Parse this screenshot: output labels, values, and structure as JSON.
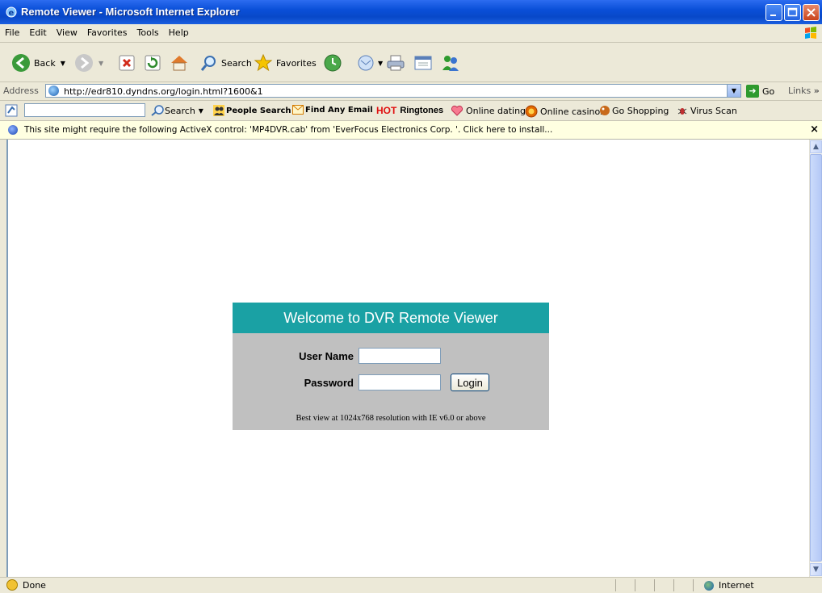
{
  "window": {
    "title": "Remote Viewer - Microsoft Internet Explorer"
  },
  "menu": [
    "File",
    "Edit",
    "View",
    "Favorites",
    "Tools",
    "Help"
  ],
  "toolbar": {
    "back": "Back",
    "search": "Search",
    "favorites": "Favorites"
  },
  "address": {
    "label": "Address",
    "url": "http://edr810.dyndns.org/login.html?1600&1",
    "go": "Go",
    "links": "Links"
  },
  "searchbar": {
    "search_label": "Search",
    "people_search": "People Search",
    "find_email": "Find Any Email",
    "hot": "HOT",
    "ringtones": "Ringtones",
    "online_dating": "Online dating",
    "online_casinos": "Online casinos",
    "go_shopping": "Go Shopping",
    "virus_scan": "Virus Scan"
  },
  "infobar": {
    "text": "This site might require the following ActiveX control: 'MP4DVR.cab' from 'EverFocus Electronics Corp. '. Click here to install..."
  },
  "login": {
    "title": "Welcome to DVR Remote Viewer",
    "username_label": "User Name",
    "password_label": "Password",
    "login_button": "Login",
    "note": "Best view at 1024x768 resolution with IE v6.0 or above"
  },
  "status": {
    "text": "Done",
    "zone": "Internet"
  },
  "colors": {
    "accent": "#1aa1a4",
    "panel": "#c0c0c0",
    "chrome": "#ece9d8"
  }
}
